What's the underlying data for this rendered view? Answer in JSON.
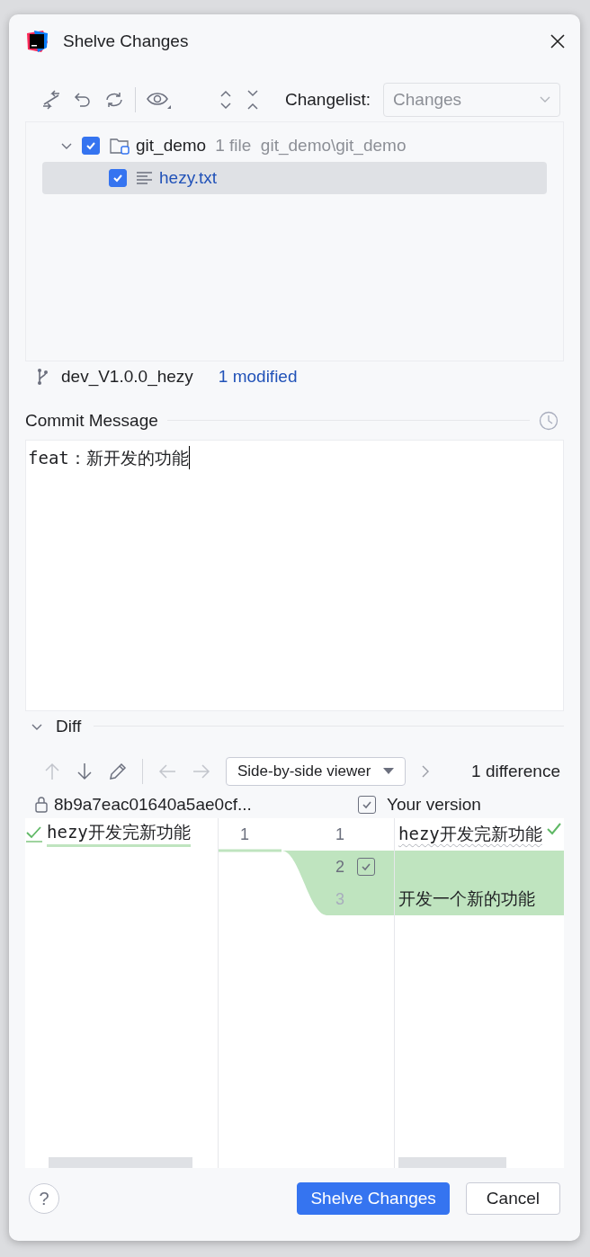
{
  "window": {
    "title": "Shelve Changes"
  },
  "toolbar": {
    "changelist_label": "Changelist:",
    "changelist_value": "Changes"
  },
  "tree": [
    {
      "name": "git_demo",
      "meta": "1 file  git_demo\\git_demo",
      "checked": true,
      "expanded": true,
      "selected": false,
      "children": [
        {
          "name": "hezy.txt",
          "checked": true,
          "selected": true
        }
      ]
    }
  ],
  "branch": {
    "name": "dev_V1.0.0_hezy",
    "status": "1 modified"
  },
  "commit": {
    "label": "Commit Message",
    "value": "feat：新开发的功能"
  },
  "diff": {
    "title": "Diff",
    "expanded": true,
    "viewer": "Side-by-side viewer",
    "count": "1 difference",
    "left_title": "8b9a7eac01640a5ae0cf...",
    "right_title": "Your version",
    "right_checked": true,
    "left_lines": [
      {
        "number": "1",
        "text": "hezy开发完新功能"
      }
    ],
    "right_lines": [
      {
        "number": "1",
        "text": "hezy开发完新功能",
        "changed": false
      },
      {
        "number": "2",
        "changed": true,
        "checked": true
      },
      {
        "number": "3",
        "text": "开发一个新的功能",
        "changed": true
      }
    ]
  },
  "help": {
    "label": "?"
  },
  "buttons": [
    {
      "label": "Shelve Changes",
      "kind": "primary"
    },
    {
      "label": "Cancel",
      "kind": "secondary"
    }
  ]
}
